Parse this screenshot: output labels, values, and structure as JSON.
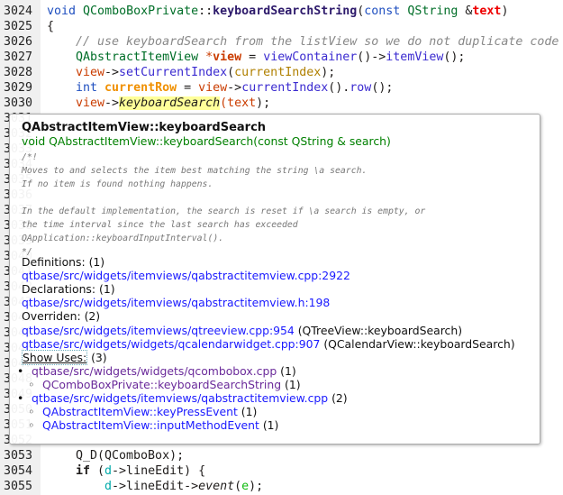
{
  "lines_top": [
    {
      "n": "3024"
    },
    {
      "n": "3025"
    },
    {
      "n": "3026"
    },
    {
      "n": "3027"
    },
    {
      "n": "3028"
    },
    {
      "n": "3029"
    },
    {
      "n": "3030"
    }
  ],
  "code": {
    "l3024": {
      "a": "void",
      "b": "QComboBoxPrivate",
      "c": "::",
      "d": "keyboardSearchString",
      "e": "(",
      "f": "const",
      "g": "QString",
      "h": "&",
      "i": "text",
      ")": ")"
    },
    "l3025": "{",
    "l3026": "// use keyboardSearch from the listView so we do not duplicate code",
    "l3027": {
      "a": "QAbstractItemView",
      "b": "*",
      "c": "view",
      "d": " = ",
      "e": "viewContainer",
      "f": "()->",
      "g": "itemView",
      "h": "();"
    },
    "l3028": {
      "a": "view",
      "b": "->",
      "c": "setCurrentIndex",
      "d": "(",
      "e": "currentIndex",
      "f": ");"
    },
    "l3029": {
      "a": "int",
      "b": "currentRow",
      "c": " = ",
      "d": "view",
      "e": "->",
      "f": "currentIndex",
      "g": "().",
      "h": "row",
      "i": "();"
    },
    "l3030": {
      "a": "view",
      "b": "->",
      "c": "keyboardSearch",
      "d": "(",
      "e": "text",
      "f": ");"
    },
    "l3053": {
      "a": "Q_D(QComboBox);"
    },
    "l3054": {
      "a": "if",
      "b": " (",
      "c": "d",
      "d": "->lineEdit) {"
    },
    "l3055": {
      "a": "d",
      "b": "->lineEdit->",
      "c": "event",
      "d": "(",
      "e": "e",
      "f": ");"
    }
  },
  "bottom_lines": [
    "3053",
    "3054",
    "3055"
  ],
  "hidden_lines": [
    "3031",
    "3032",
    "3033",
    "3034",
    "3035",
    "3036",
    "3037",
    "3038",
    "3039",
    "3040",
    "3041",
    "3042",
    "3043",
    "3044",
    "3045",
    "3046",
    "3047",
    "3048",
    "3049",
    "3050",
    "3051",
    "3052"
  ],
  "tooltip": {
    "title": "QAbstractItemView::keyboardSearch",
    "signature": "void QAbstractItemView::keyboardSearch(const QString & search)",
    "doc": [
      "/*!",
      "  Moves to and selects the item best matching the string \\a search.",
      "  If no item is found nothing happens.",
      "",
      "  In the default implementation, the search is reset if \\a search is empty, or",
      "  the time interval since the last search has exceeded",
      "  QApplication::keyboardInputInterval().",
      "*/"
    ],
    "definitions_label": "Definitions: (1)",
    "definitions": [
      "qtbase/src/widgets/itemviews/qabstractitemview.cpp:2922"
    ],
    "declarations_label": "Declarations: (1)",
    "declarations": [
      "qtbase/src/widgets/itemviews/qabstractitemview.h:198"
    ],
    "overriden_label": "Overriden: (2)",
    "overriden": [
      {
        "link": "qtbase/src/widgets/itemviews/qtreeview.cpp:954",
        "note": " (QTreeView::keyboardSearch)"
      },
      {
        "link": "qtbase/src/widgets/widgets/qcalendarwidget.cpp:907",
        "note": " (QCalendarView::keyboardSearch)"
      }
    ],
    "show_uses": "Show Uses:",
    "uses_count": " (3)",
    "uses": [
      {
        "file": "qtbase/src/widgets/widgets/qcombobox.cpp",
        "count": " (1)",
        "visited": true,
        "items": [
          {
            "name": "QComboBoxPrivate::keyboardSearchString",
            "count": " (1)"
          }
        ]
      },
      {
        "file": "qtbase/src/widgets/itemviews/qabstractitemview.cpp",
        "count": " (2)",
        "visited": false,
        "items": [
          {
            "name": "QAbstractItemView::keyPressEvent",
            "count": " (1)"
          },
          {
            "name": "QAbstractItemView::inputMethodEvent",
            "count": " (1)"
          }
        ]
      }
    ]
  }
}
